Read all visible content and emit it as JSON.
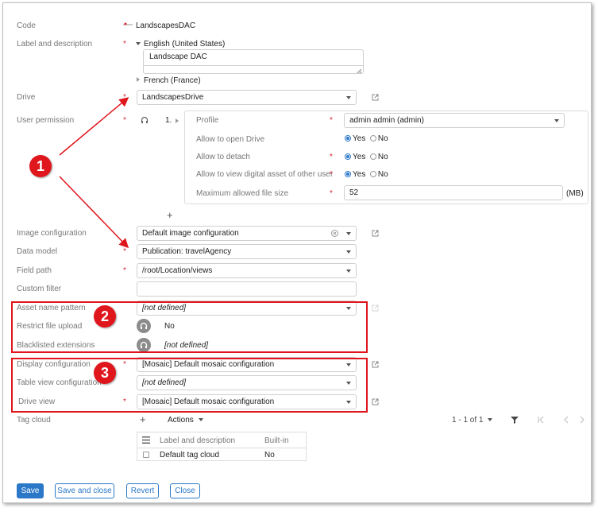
{
  "form": {
    "code": {
      "label": "Code",
      "value": "LandscapesDAC"
    },
    "label_description": {
      "label": "Label and description",
      "english": "English (United States)",
      "english_value": "Landscape DAC",
      "french": "French (France)"
    },
    "drive": {
      "label": "Drive",
      "value": "LandscapesDrive"
    },
    "user_permission": {
      "label": "User permission",
      "index": "1.",
      "profile_label": "Profile",
      "profile_value": "admin admin (admin)",
      "open_drive_label": "Allow to open Drive",
      "detach_label": "Allow to detach",
      "view_other_label": "Allow to view digital asset of other user",
      "max_size_label": "Maximum allowed file size",
      "max_size_value": "52",
      "max_size_unit": "(MB)",
      "yes": "Yes",
      "no": "No",
      "add": "+"
    },
    "image_config": {
      "label": "Image configuration",
      "value": "Default image configuration"
    },
    "data_model": {
      "label": "Data model",
      "value": "Publication: travelAgency"
    },
    "field_path": {
      "label": "Field path",
      "value": "/root/Location/views"
    },
    "custom_filter": {
      "label": "Custom filter",
      "value": ""
    },
    "asset_name_pattern": {
      "label": "Asset name pattern",
      "value": "[not defined]"
    },
    "restrict_upload": {
      "label": "Restrict file upload",
      "value": "No"
    },
    "blacklisted": {
      "label": "Blacklisted extensions",
      "value": "[not defined]"
    },
    "display_config": {
      "label": "Display configuration",
      "value": "[Mosaic] Default mosaic configuration"
    },
    "table_view_config": {
      "label": "Table view configuration",
      "value": "[not defined]"
    },
    "drive_view": {
      "label": "Drive view",
      "value": "[Mosaic] Default mosaic configuration"
    },
    "tag_cloud": {
      "label": "Tag cloud",
      "add": "+",
      "actions": "Actions",
      "pagination": "1 - 1 of 1",
      "columns": [
        "Label and description",
        "Built-in"
      ],
      "rows": [
        {
          "label": "Default tag cloud",
          "builtin": "No"
        }
      ]
    }
  },
  "annotations": {
    "badge1": "1",
    "badge2": "2",
    "badge3": "3",
    "color": "#e0161d"
  },
  "footer": {
    "save": "Save",
    "save_close": "Save and close",
    "revert": "Revert",
    "close": "Close"
  },
  "colors": {
    "accent": "#2a78c7",
    "required": "#d9262d"
  }
}
